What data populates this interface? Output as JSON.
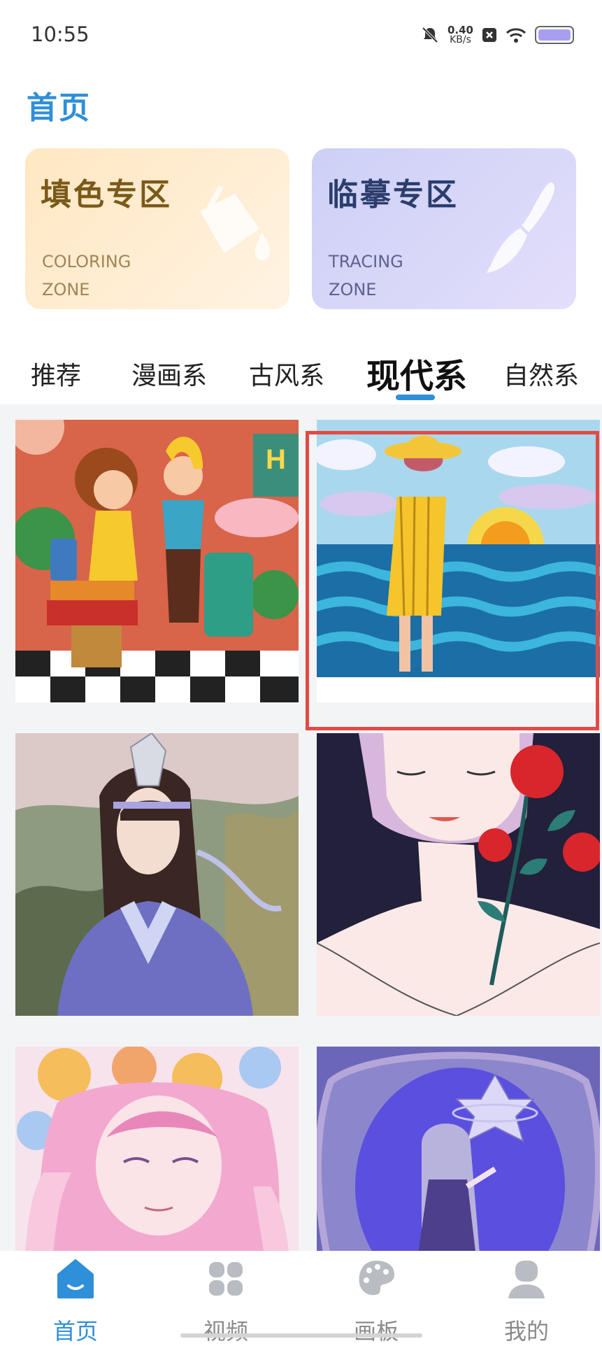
{
  "status_bar": {
    "time": "10:55",
    "net_speed_value": "0.40",
    "net_speed_unit": "KB/s",
    "icons": [
      "bell-muted-icon",
      "x-box-icon",
      "wifi-icon",
      "battery-icon"
    ]
  },
  "header": {
    "title": "首页"
  },
  "zones": [
    {
      "title": "填色专区",
      "sub1": "COLORING",
      "sub2": "ZONE",
      "icon": "paint-bucket-icon"
    },
    {
      "title": "临摹专区",
      "sub1": "TRACING",
      "sub2": "ZONE",
      "icon": "brush-icon"
    }
  ],
  "tabs": [
    {
      "label": "推荐"
    },
    {
      "label": "漫画系"
    },
    {
      "label": "古风系"
    },
    {
      "label": "现代系",
      "active": true
    },
    {
      "label": "自然系"
    }
  ],
  "gallery": {
    "items": [
      {
        "subject": "travel-girls-illustration"
      },
      {
        "subject": "beach-girl-sunset-illustration",
        "highlighted": true
      },
      {
        "subject": "ancient-style-swordsman-illustration"
      },
      {
        "subject": "woman-with-roses-illustration"
      },
      {
        "subject": "pink-hair-flowers-illustration"
      },
      {
        "subject": "purple-fantasy-girl-illustration"
      }
    ]
  },
  "bottom_nav": [
    {
      "label": "首页",
      "icon": "home-icon",
      "active": true
    },
    {
      "label": "视频",
      "icon": "video-grid-icon"
    },
    {
      "label": "画板",
      "icon": "palette-icon"
    },
    {
      "label": "我的",
      "icon": "profile-icon"
    }
  ],
  "colors": {
    "accent": "#2f8fd8",
    "highlight_border": "#e34a44"
  }
}
